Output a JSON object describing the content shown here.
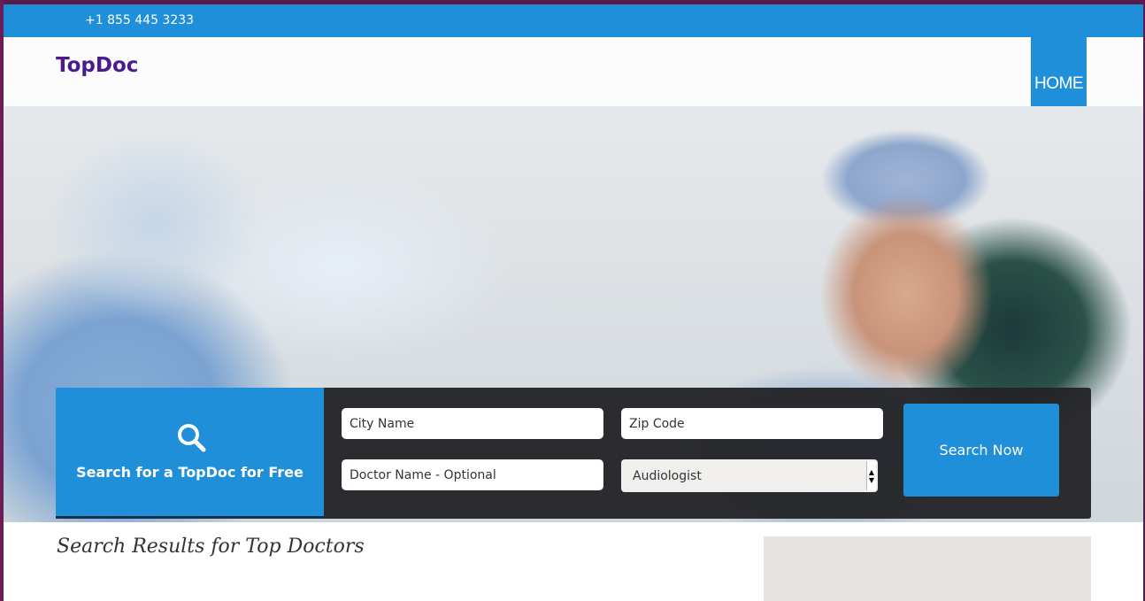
{
  "topbar": {
    "phone": "+1 855 445 3233"
  },
  "header": {
    "logo": "TopDoc",
    "nav": [
      {
        "label": "HOME",
        "active": true
      }
    ]
  },
  "search": {
    "promo_text": "Search for a TopDoc for Free",
    "promo_icon": "search-icon",
    "city_placeholder": "City Name",
    "zip_placeholder": "Zip Code",
    "doctor_placeholder": "Doctor Name - Optional",
    "specialty_selected": "Audiologist",
    "submit_label": "Search Now"
  },
  "results": {
    "title": "Search Results for Top Doctors"
  },
  "colors": {
    "brand_blue": "#1f8fd9",
    "logo_purple": "#4b1a8c",
    "search_bg": "#232326"
  }
}
